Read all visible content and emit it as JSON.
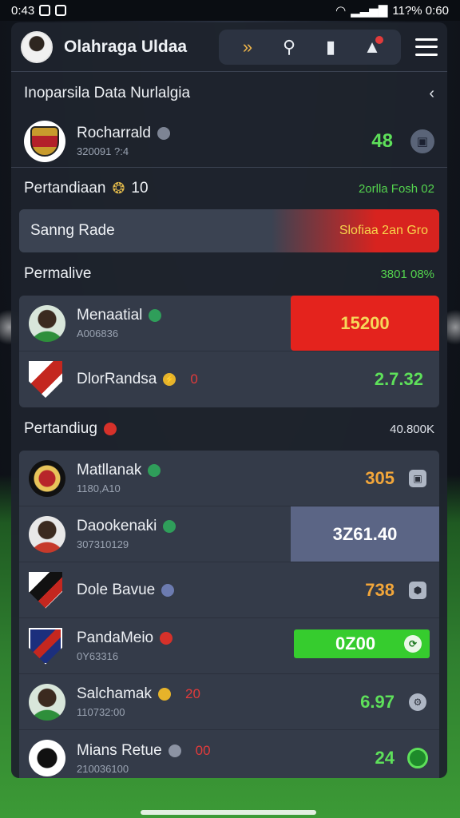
{
  "status_bar": {
    "time": "0:43",
    "right_text": "11?% 0:60"
  },
  "header": {
    "title": "Olahraga Uldaa"
  },
  "section1": {
    "title": "Inoparsila Data Nurlalgia",
    "featured": {
      "name": "Rocharrald",
      "sub": "320091 ?:4",
      "score": "48"
    }
  },
  "match": {
    "label": "Pertandiaan",
    "num": "10",
    "right": "2orlla Fosh 02"
  },
  "live": {
    "label": "Sanng Rade",
    "right": "Slofiaa 2an Gro"
  },
  "section2": {
    "title": "Permalive",
    "right": "3801 08%",
    "rows": [
      {
        "name": "Menaatial",
        "sub": "A006836",
        "value": "15200"
      },
      {
        "name": "DlorRandsa",
        "sub": "",
        "badge": "0",
        "value": "2.7.32"
      }
    ]
  },
  "section3": {
    "title": "Pertandiug",
    "right": "40.800K",
    "rows": [
      {
        "name": "Matllanak",
        "sub": "1180,A10",
        "value": "305"
      },
      {
        "name": "Daookenaki",
        "sub": "307310129",
        "value": "3Z61.40"
      },
      {
        "name": "Dole Bavue",
        "sub": "",
        "value": "738"
      },
      {
        "name": "PandaMeio",
        "sub": "0Y63316",
        "value": "0Z00"
      },
      {
        "name": "Salchamak",
        "sub": "110732:00",
        "badge": "20",
        "value": "6.97"
      },
      {
        "name": "Mians Retue",
        "sub": "210036100",
        "badge": "00",
        "value": "24"
      }
    ]
  }
}
